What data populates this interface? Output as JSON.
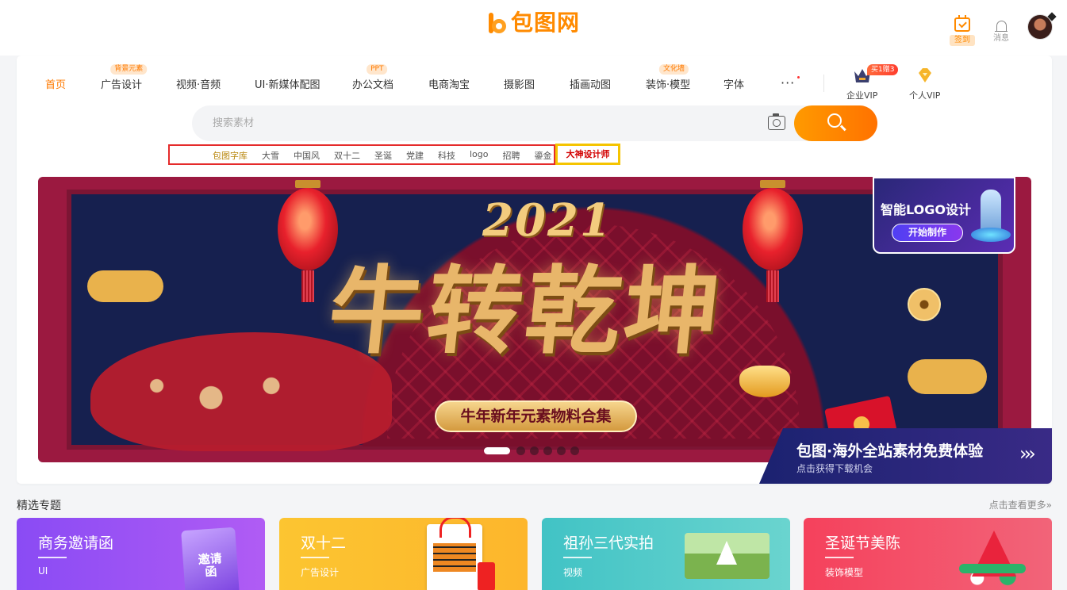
{
  "header": {
    "logo_text": "包图网",
    "signin_label": "签到",
    "messages_label": "消息"
  },
  "nav": {
    "items": [
      {
        "label": "首页",
        "active": true
      },
      {
        "label": "广告设计",
        "badge": "背景元素"
      },
      {
        "label": "视频·音频"
      },
      {
        "label": "UI·新媒体配图"
      },
      {
        "label": "办公文档",
        "badge": "PPT"
      },
      {
        "label": "电商淘宝"
      },
      {
        "label": "摄影图"
      },
      {
        "label": "插画动图"
      },
      {
        "label": "装饰·模型",
        "badge": "文化墙"
      },
      {
        "label": "字体"
      }
    ],
    "more_label": "···",
    "vip": [
      {
        "label": "企业VIP",
        "tag": "买1赠3"
      },
      {
        "label": "个人VIP"
      }
    ]
  },
  "search": {
    "placeholder": "搜索素材",
    "value": ""
  },
  "hot_keywords": [
    "包图字库",
    "大雪",
    "中国风",
    "双十二",
    "圣诞",
    "党建",
    "科技",
    "logo",
    "招聘",
    "鎏金"
  ],
  "hot_special": "大神设计师",
  "banner": {
    "year": "2021",
    "title": "牛转乾坤",
    "subtitle": "牛年新年元素物料合集",
    "slides_count": 6,
    "active_slide": 1
  },
  "logo_ad": {
    "title": "智能LOGO设计",
    "button": "开始制作"
  },
  "overseas": {
    "title": "包图·海外全站素材免费体验",
    "subtitle": "点击获得下载机会",
    "arrow": "›››"
  },
  "featured": {
    "title": "精选专题",
    "more": "点击查看更多»",
    "cards": [
      {
        "title": "商务邀请函",
        "tag": "UI",
        "deco_text": "邀请函"
      },
      {
        "title": "双十二",
        "tag": "广告设计"
      },
      {
        "title": "祖孙三代实拍",
        "tag": "视频"
      },
      {
        "title": "圣诞节美陈",
        "tag": "装饰模型"
      }
    ]
  },
  "colors": {
    "accent": "#ff8a00",
    "hot_border": "#e52b2b",
    "special_border": "#f5c400"
  }
}
